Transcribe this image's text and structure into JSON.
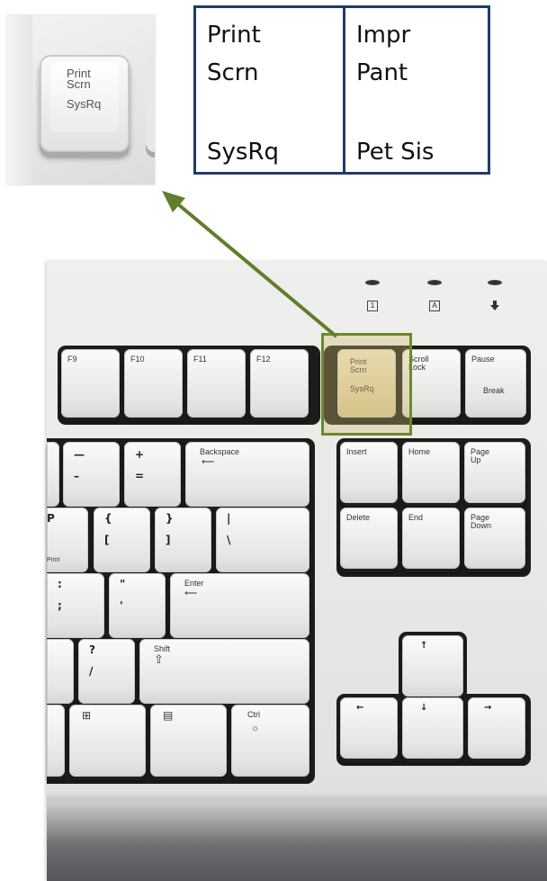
{
  "inset": {
    "key_line1": "Print",
    "key_line2": "Scrn",
    "key_line3": "SysRq"
  },
  "translation_table": {
    "english": {
      "line1": "Print",
      "line2": "Scrn",
      "line3": "SysRq"
    },
    "spanish": {
      "line1": "Impr",
      "line2": "Pant",
      "line3": "Pet Sis"
    }
  },
  "leds": {
    "num_lock_icon": "1",
    "caps_lock_icon": "A",
    "scroll_lock_icon": "down-arrow-icon"
  },
  "keys": {
    "f9": "F9",
    "f10": "F10",
    "f11": "F11",
    "f12": "F12",
    "print_screen": "Print\nScrn",
    "print_screen_sub": "SysRq",
    "scroll_lock": "Scroll\nLock",
    "pause": "Pause",
    "pause_sub": "Break",
    "minus_top": "—",
    "minus_bottom": "–",
    "equals_top": "+",
    "equals_bottom": "=",
    "backspace": "Backspace",
    "insert": "Insert",
    "home": "Home",
    "page_up": "Page\nUp",
    "delete": "Delete",
    "end": "End",
    "page_down": "Page\nDown",
    "p_partial": "P",
    "p_print": "Print",
    "lbrace_top": "{",
    "lbrace_bottom": "[",
    "rbrace_top": "}",
    "rbrace_bottom": "]",
    "pipe_top": "|",
    "pipe_bottom": "\\",
    "colon_top": ":",
    "colon_bottom": ";",
    "quote_top": "\"",
    "quote_bottom": "'",
    "enter": "Enter",
    "question_top": "?",
    "question_bottom": "/",
    "shift": "Shift",
    "ctrl": "Ctrl",
    "arrow_up": "↑",
    "arrow_down": "↓",
    "arrow_left": "←",
    "arrow_right": "→"
  },
  "colors": {
    "table_border": "#1f3b6d",
    "arrow": "#5f7f28",
    "highlight_fill": "#d2b96e"
  }
}
